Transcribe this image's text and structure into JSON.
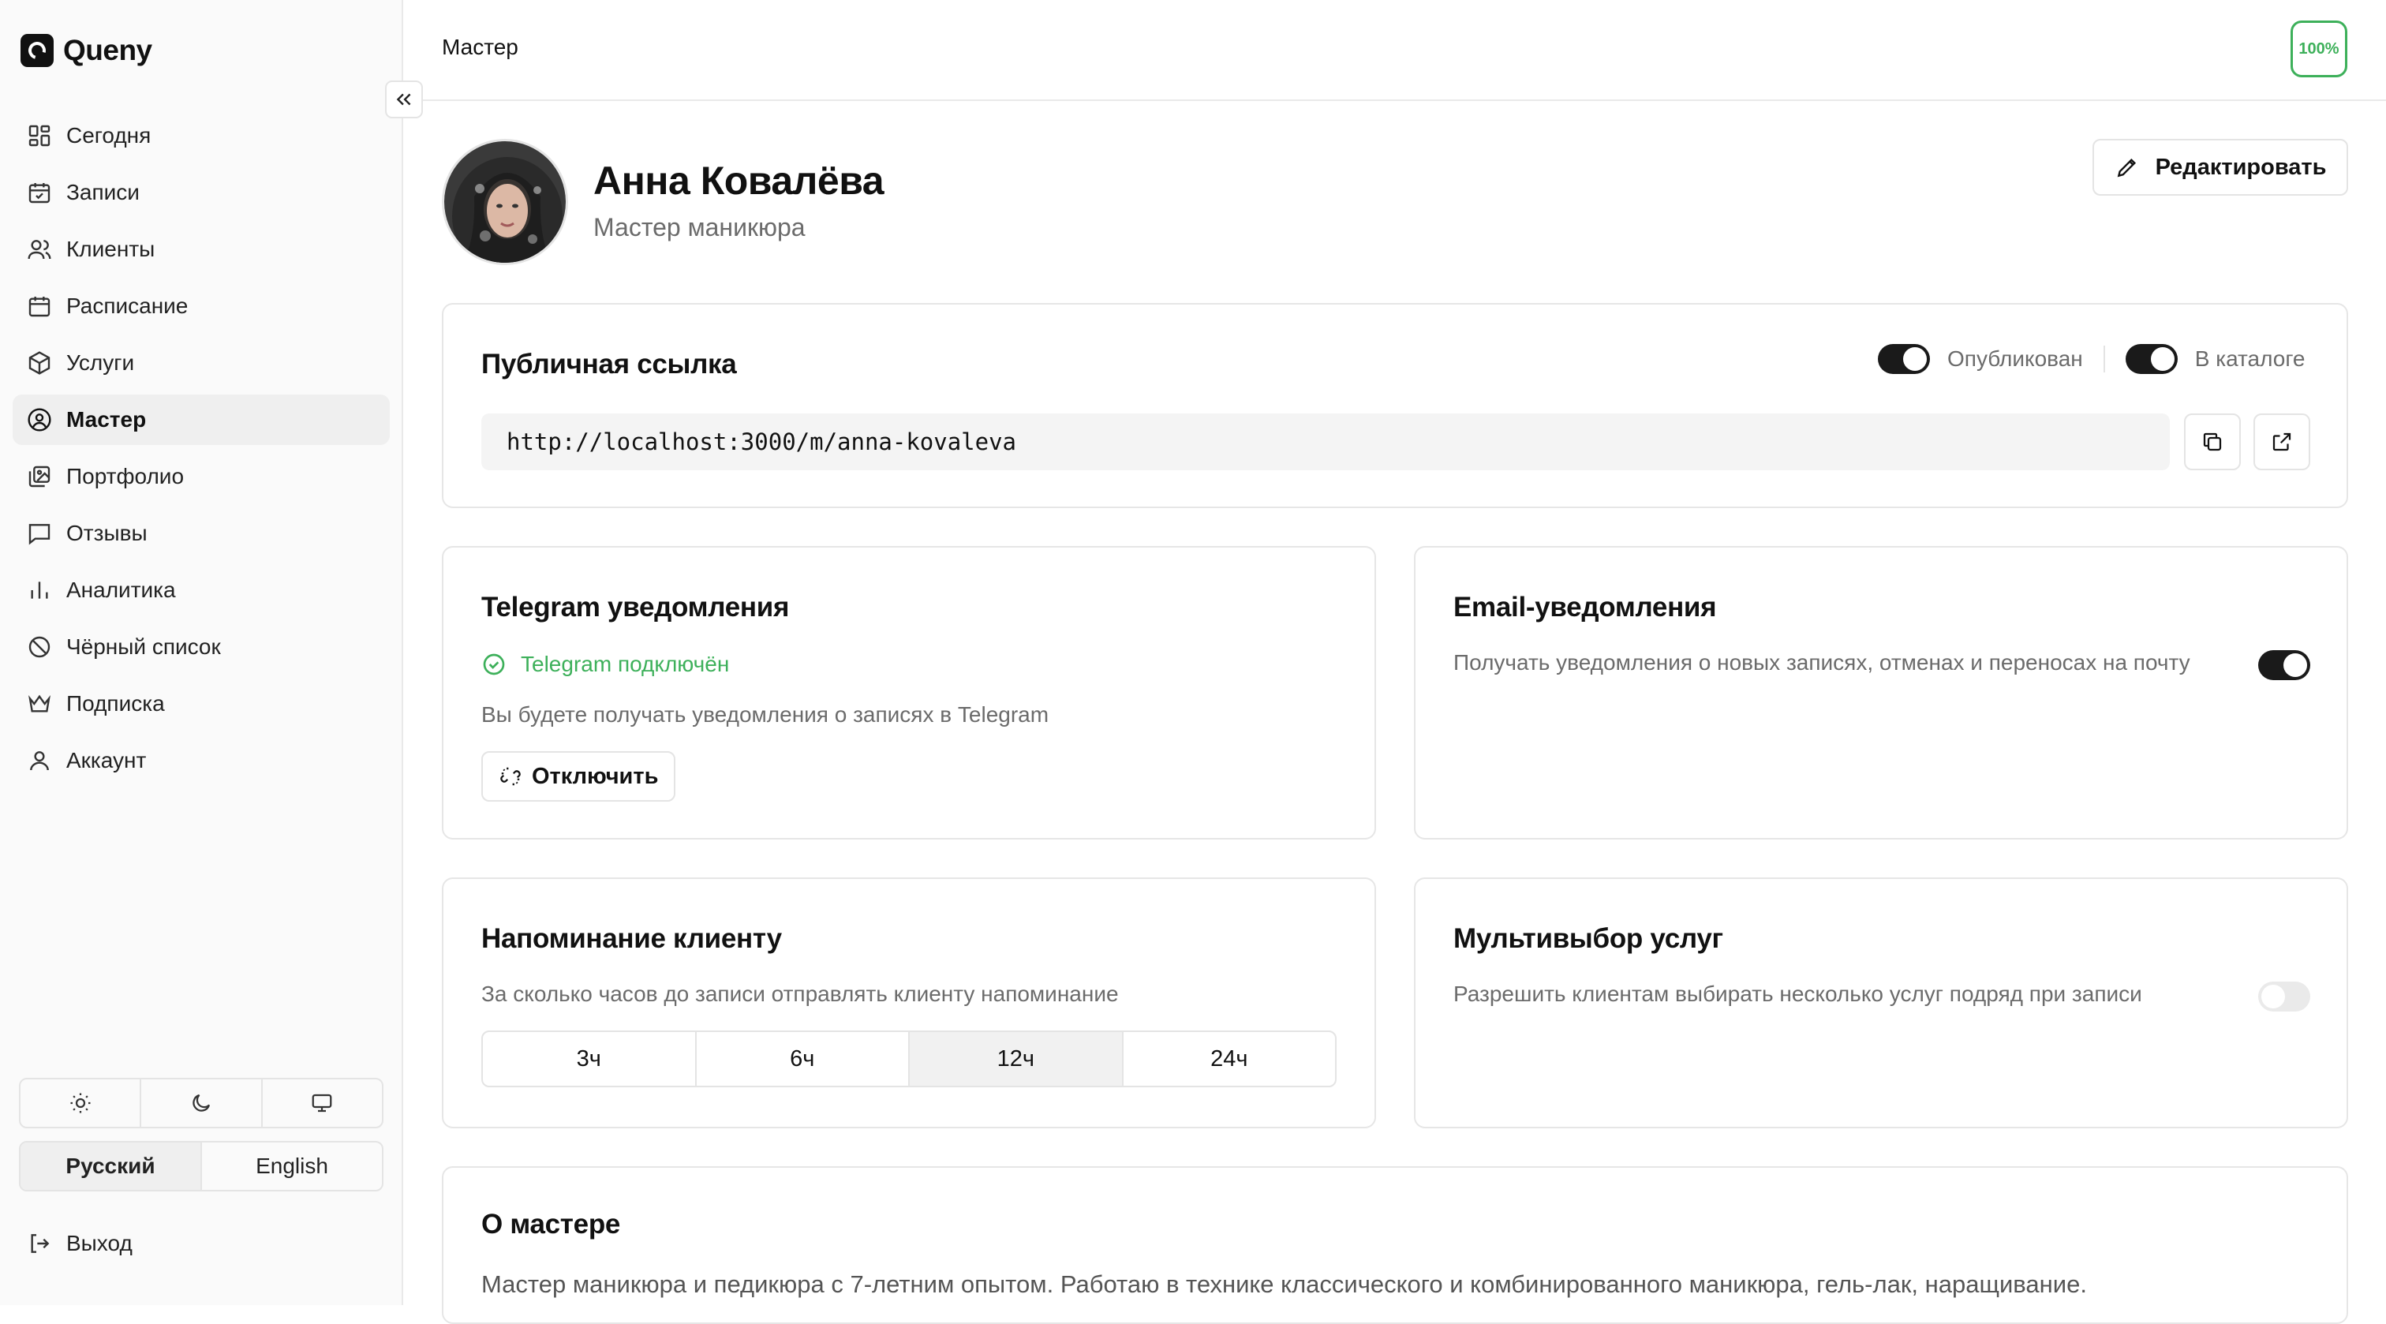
{
  "app": {
    "name": "Queny"
  },
  "sidebar": {
    "items": [
      {
        "label": "Сегодня",
        "icon": "dashboard-icon"
      },
      {
        "label": "Записи",
        "icon": "calendar-check-icon"
      },
      {
        "label": "Клиенты",
        "icon": "users-icon"
      },
      {
        "label": "Расписание",
        "icon": "calendar-icon"
      },
      {
        "label": "Услуги",
        "icon": "package-icon"
      },
      {
        "label": "Мастер",
        "icon": "user-circle-icon",
        "active": true
      },
      {
        "label": "Портфолио",
        "icon": "images-icon"
      },
      {
        "label": "Отзывы",
        "icon": "message-icon"
      },
      {
        "label": "Аналитика",
        "icon": "bar-chart-icon"
      },
      {
        "label": "Чёрный список",
        "icon": "ban-icon"
      },
      {
        "label": "Подписка",
        "icon": "crown-icon"
      },
      {
        "label": "Аккаунт",
        "icon": "user-icon"
      }
    ],
    "languages": {
      "ru": "Русский",
      "en": "English",
      "selected": "Русский"
    },
    "logout": "Выход"
  },
  "header": {
    "title": "Мастер",
    "progress": "100%"
  },
  "profile": {
    "name": "Анна Ковалёва",
    "role": "Мастер маникюра",
    "edit_label": "Редактировать"
  },
  "public_link": {
    "title": "Публичная ссылка",
    "published_label": "Опубликован",
    "published": true,
    "catalog_label": "В каталоге",
    "in_catalog": true,
    "url": "http://localhost:3000/m/anna-kovaleva"
  },
  "telegram": {
    "title": "Telegram уведомления",
    "status": "Telegram подключён",
    "description": "Вы будете получать уведомления о записях в Telegram",
    "disconnect_label": "Отключить"
  },
  "email": {
    "title": "Email-уведомления",
    "description": "Получать уведомления о новых записях, отменах и переносах на почту",
    "enabled": true
  },
  "reminder": {
    "title": "Напоминание клиенту",
    "description": "За сколько часов до записи отправлять клиенту напоминание",
    "options": [
      "3ч",
      "6ч",
      "12ч",
      "24ч"
    ],
    "selected": "12ч"
  },
  "multiselect": {
    "title": "Мультивыбор услуг",
    "description": "Разрешить клиентам выбирать несколько услуг подряд при записи",
    "enabled": false
  },
  "about": {
    "title": "О мастере",
    "text": "Мастер маникюра и педикюра с 7-летним опытом. Работаю в технике классического и комбинированного маникюра, гель-лак, наращивание."
  },
  "colors": {
    "accent": "#111111",
    "success": "#3db05a",
    "muted": "#6b6b6b",
    "border": "#e6e6e6"
  }
}
